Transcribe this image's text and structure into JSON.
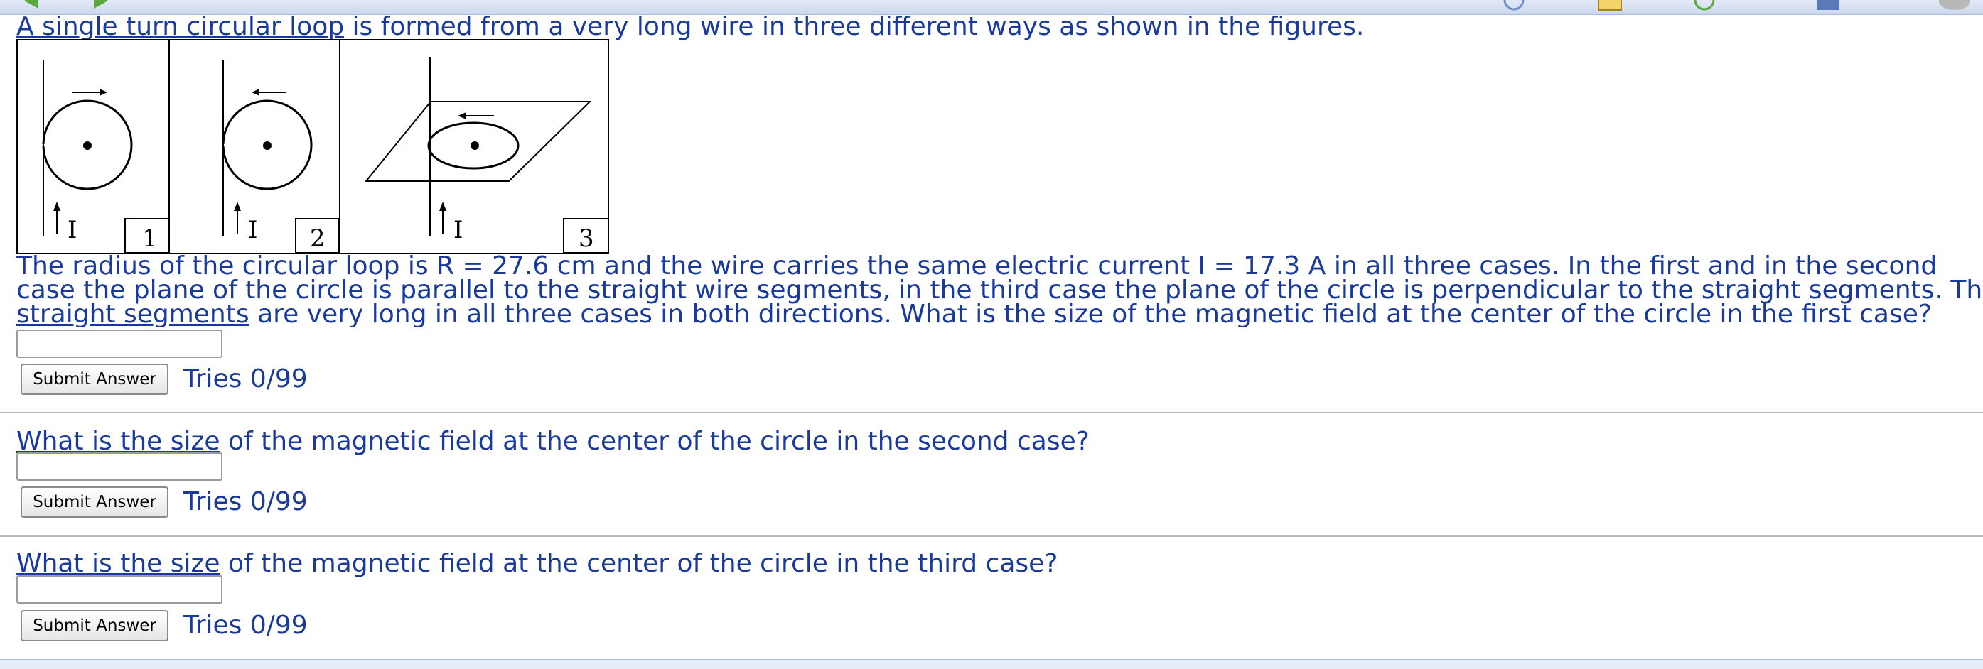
{
  "intro": {
    "underlined": "A single turn circular loop",
    "rest": " is formed from a very long wire in three different ways as shown in the figures."
  },
  "figure": {
    "current_label": "I",
    "panels": [
      "1",
      "2",
      "3"
    ]
  },
  "main_text": {
    "line1": "The radius of the circular loop is R = 27.6 cm and the wire carries the same electric current I = 17.3 A in all three cases. In the first and in the second",
    "line2": "case the plane of the circle is parallel to the straight wire segments, in the third case the plane of the circle is perpendicular to the straight segments. The",
    "line3_underlined": "straight segments",
    "line3_rest": " are very long in all three cases in both directions. What is the size of the magnetic field at the center of the circle in the first case?"
  },
  "questions": [
    {
      "underlined": "",
      "rest": "",
      "input_value": "",
      "submit_label": "Submit Answer",
      "tries": "Tries 0/99"
    },
    {
      "underlined": "What is the size",
      "rest": " of the magnetic field at the center of the circle in the second case?",
      "input_value": "",
      "submit_label": "Submit Answer",
      "tries": "Tries 0/99"
    },
    {
      "underlined": "What is the size",
      "rest": " of the magnetic field at the center of the circle in the third case?",
      "input_value": "",
      "submit_label": "Submit Answer",
      "tries": "Tries 0/99"
    }
  ],
  "colors": {
    "text": "#1a3a9a",
    "rule": "#b9b9b9",
    "toolbar": "#cdd8ee"
  }
}
